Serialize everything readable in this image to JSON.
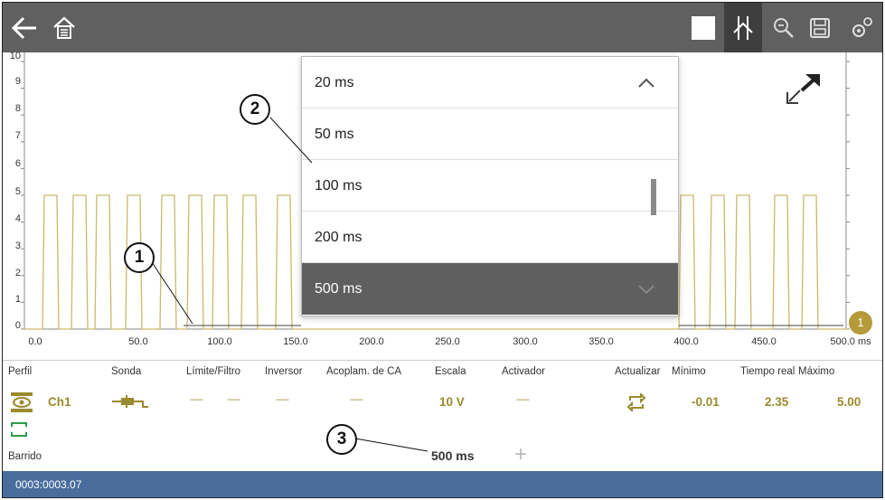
{
  "toolbar": {
    "icons": [
      "back-arrow-icon",
      "home-icon",
      "stop-icon",
      "cursor-icon",
      "zoom-icon",
      "save-icon",
      "settings-icon"
    ]
  },
  "graph": {
    "y_ticks": [
      "10",
      "9",
      "8",
      "7",
      "6",
      "5",
      "4",
      "3",
      "2",
      "1",
      "0"
    ],
    "x_ticks": [
      "0.0",
      "50.0",
      "100.0",
      "150.0",
      "200.0",
      "250.0",
      "300.0",
      "350.0",
      "400.0",
      "450.0",
      "500.0 ms"
    ],
    "trigger_marker": "1",
    "trace_color": "#c9b96a",
    "high_level": 5.0,
    "low_level": 0.0
  },
  "dropdown": {
    "options": [
      "20 ms",
      "50 ms",
      "100 ms",
      "200 ms",
      "500 ms"
    ],
    "selected": "500 ms"
  },
  "callouts": [
    "1",
    "2",
    "3"
  ],
  "panel": {
    "headers": {
      "perfil": "Perfil",
      "sonda": "Sonda",
      "limite": "Límite/Filtro",
      "inversor": "Inversor",
      "acoplam": "Acoplam. de CA",
      "escala": "Escala",
      "activador": "Activador",
      "actualizar": "Actualizar",
      "minimo": "Mínimo",
      "tiempo_real": "Tiempo real",
      "maximo": "Máximo"
    },
    "channel": "Ch1",
    "limite_dash_1": "------",
    "limite_dash_2": "------",
    "inversor_dash": "------",
    "acoplam_dash": "------",
    "escala": "10 V",
    "activador_dash": "------",
    "minimo": "-0.01",
    "tiempo_real": "2.35",
    "maximo": "5.00",
    "barrido_label": "Barrido",
    "barrido_value": "500 ms",
    "add_symbol": "+"
  },
  "status": {
    "text": "0003:0003.07"
  }
}
